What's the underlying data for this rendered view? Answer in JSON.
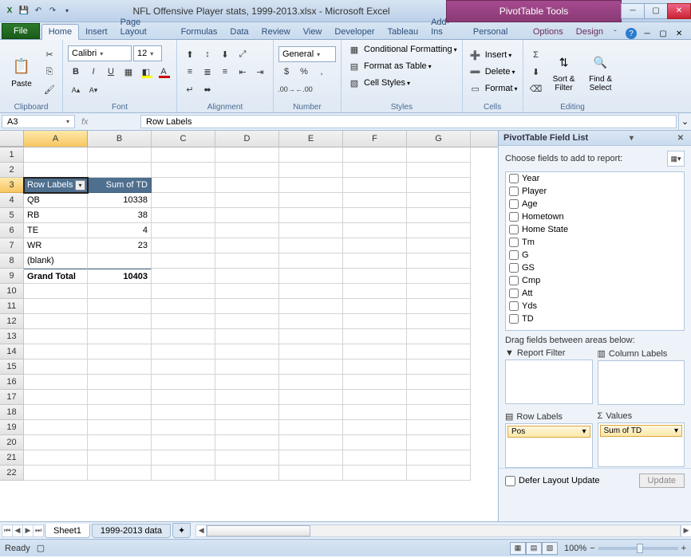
{
  "title": "NFL Offensive Player stats, 1999-2013.xlsx - Microsoft Excel",
  "contextTool": "PivotTable Tools",
  "ribbonTabs": [
    "Home",
    "Insert",
    "Page Layout",
    "Formulas",
    "Data",
    "Review",
    "View",
    "Developer",
    "Tableau",
    "Add-Ins",
    "Personal"
  ],
  "contextTabs": [
    "Options",
    "Design"
  ],
  "fileLabel": "File",
  "font": {
    "name": "Calibri",
    "size": "12"
  },
  "numberFormat": "General",
  "ribbon": {
    "conditional": "Conditional Formatting",
    "table": "Format as Table",
    "cellstyles": "Cell Styles",
    "insert": "Insert",
    "delete": "Delete",
    "format": "Format",
    "sortfilter": "Sort & Filter",
    "findselect": "Find & Select",
    "paste": "Paste",
    "groups": {
      "clipboard": "Clipboard",
      "font": "Font",
      "alignment": "Alignment",
      "number": "Number",
      "styles": "Styles",
      "cells": "Cells",
      "editing": "Editing"
    }
  },
  "nameBox": "A3",
  "formula": "Row Labels",
  "columns": [
    "A",
    "B",
    "C",
    "D",
    "E",
    "F",
    "G"
  ],
  "rows": [
    1,
    2,
    3,
    4,
    5,
    6,
    7,
    8,
    9,
    10,
    11,
    12,
    13,
    14,
    15,
    16,
    17,
    18,
    19,
    20,
    21,
    22
  ],
  "pivot": {
    "headerA": "Row Labels",
    "headerB": "Sum of TD",
    "data": [
      {
        "label": "QB",
        "value": "10338"
      },
      {
        "label": "RB",
        "value": "38"
      },
      {
        "label": "TE",
        "value": "4"
      },
      {
        "label": "WR",
        "value": "23"
      },
      {
        "label": "(blank)",
        "value": ""
      }
    ],
    "totalLabel": "Grand Total",
    "totalValue": "10403"
  },
  "sheetTabs": {
    "active": "Sheet1",
    "other": "1999-2013 data"
  },
  "pane": {
    "title": "PivotTable Field List",
    "choose": "Choose fields to add to report:",
    "fields": [
      "Year",
      "Player",
      "Age",
      "Hometown",
      "Home State",
      "Tm",
      "G",
      "GS",
      "Cmp",
      "Att",
      "Yds",
      "TD"
    ],
    "drag": "Drag fields between areas below:",
    "reportFilter": "Report Filter",
    "columnLabels": "Column Labels",
    "rowLabels": "Row Labels",
    "values": "Values",
    "rowPill": "Pos",
    "valPill": "Sum of TD",
    "defer": "Defer Layout Update",
    "update": "Update"
  },
  "status": {
    "ready": "Ready",
    "zoom": "100%"
  }
}
